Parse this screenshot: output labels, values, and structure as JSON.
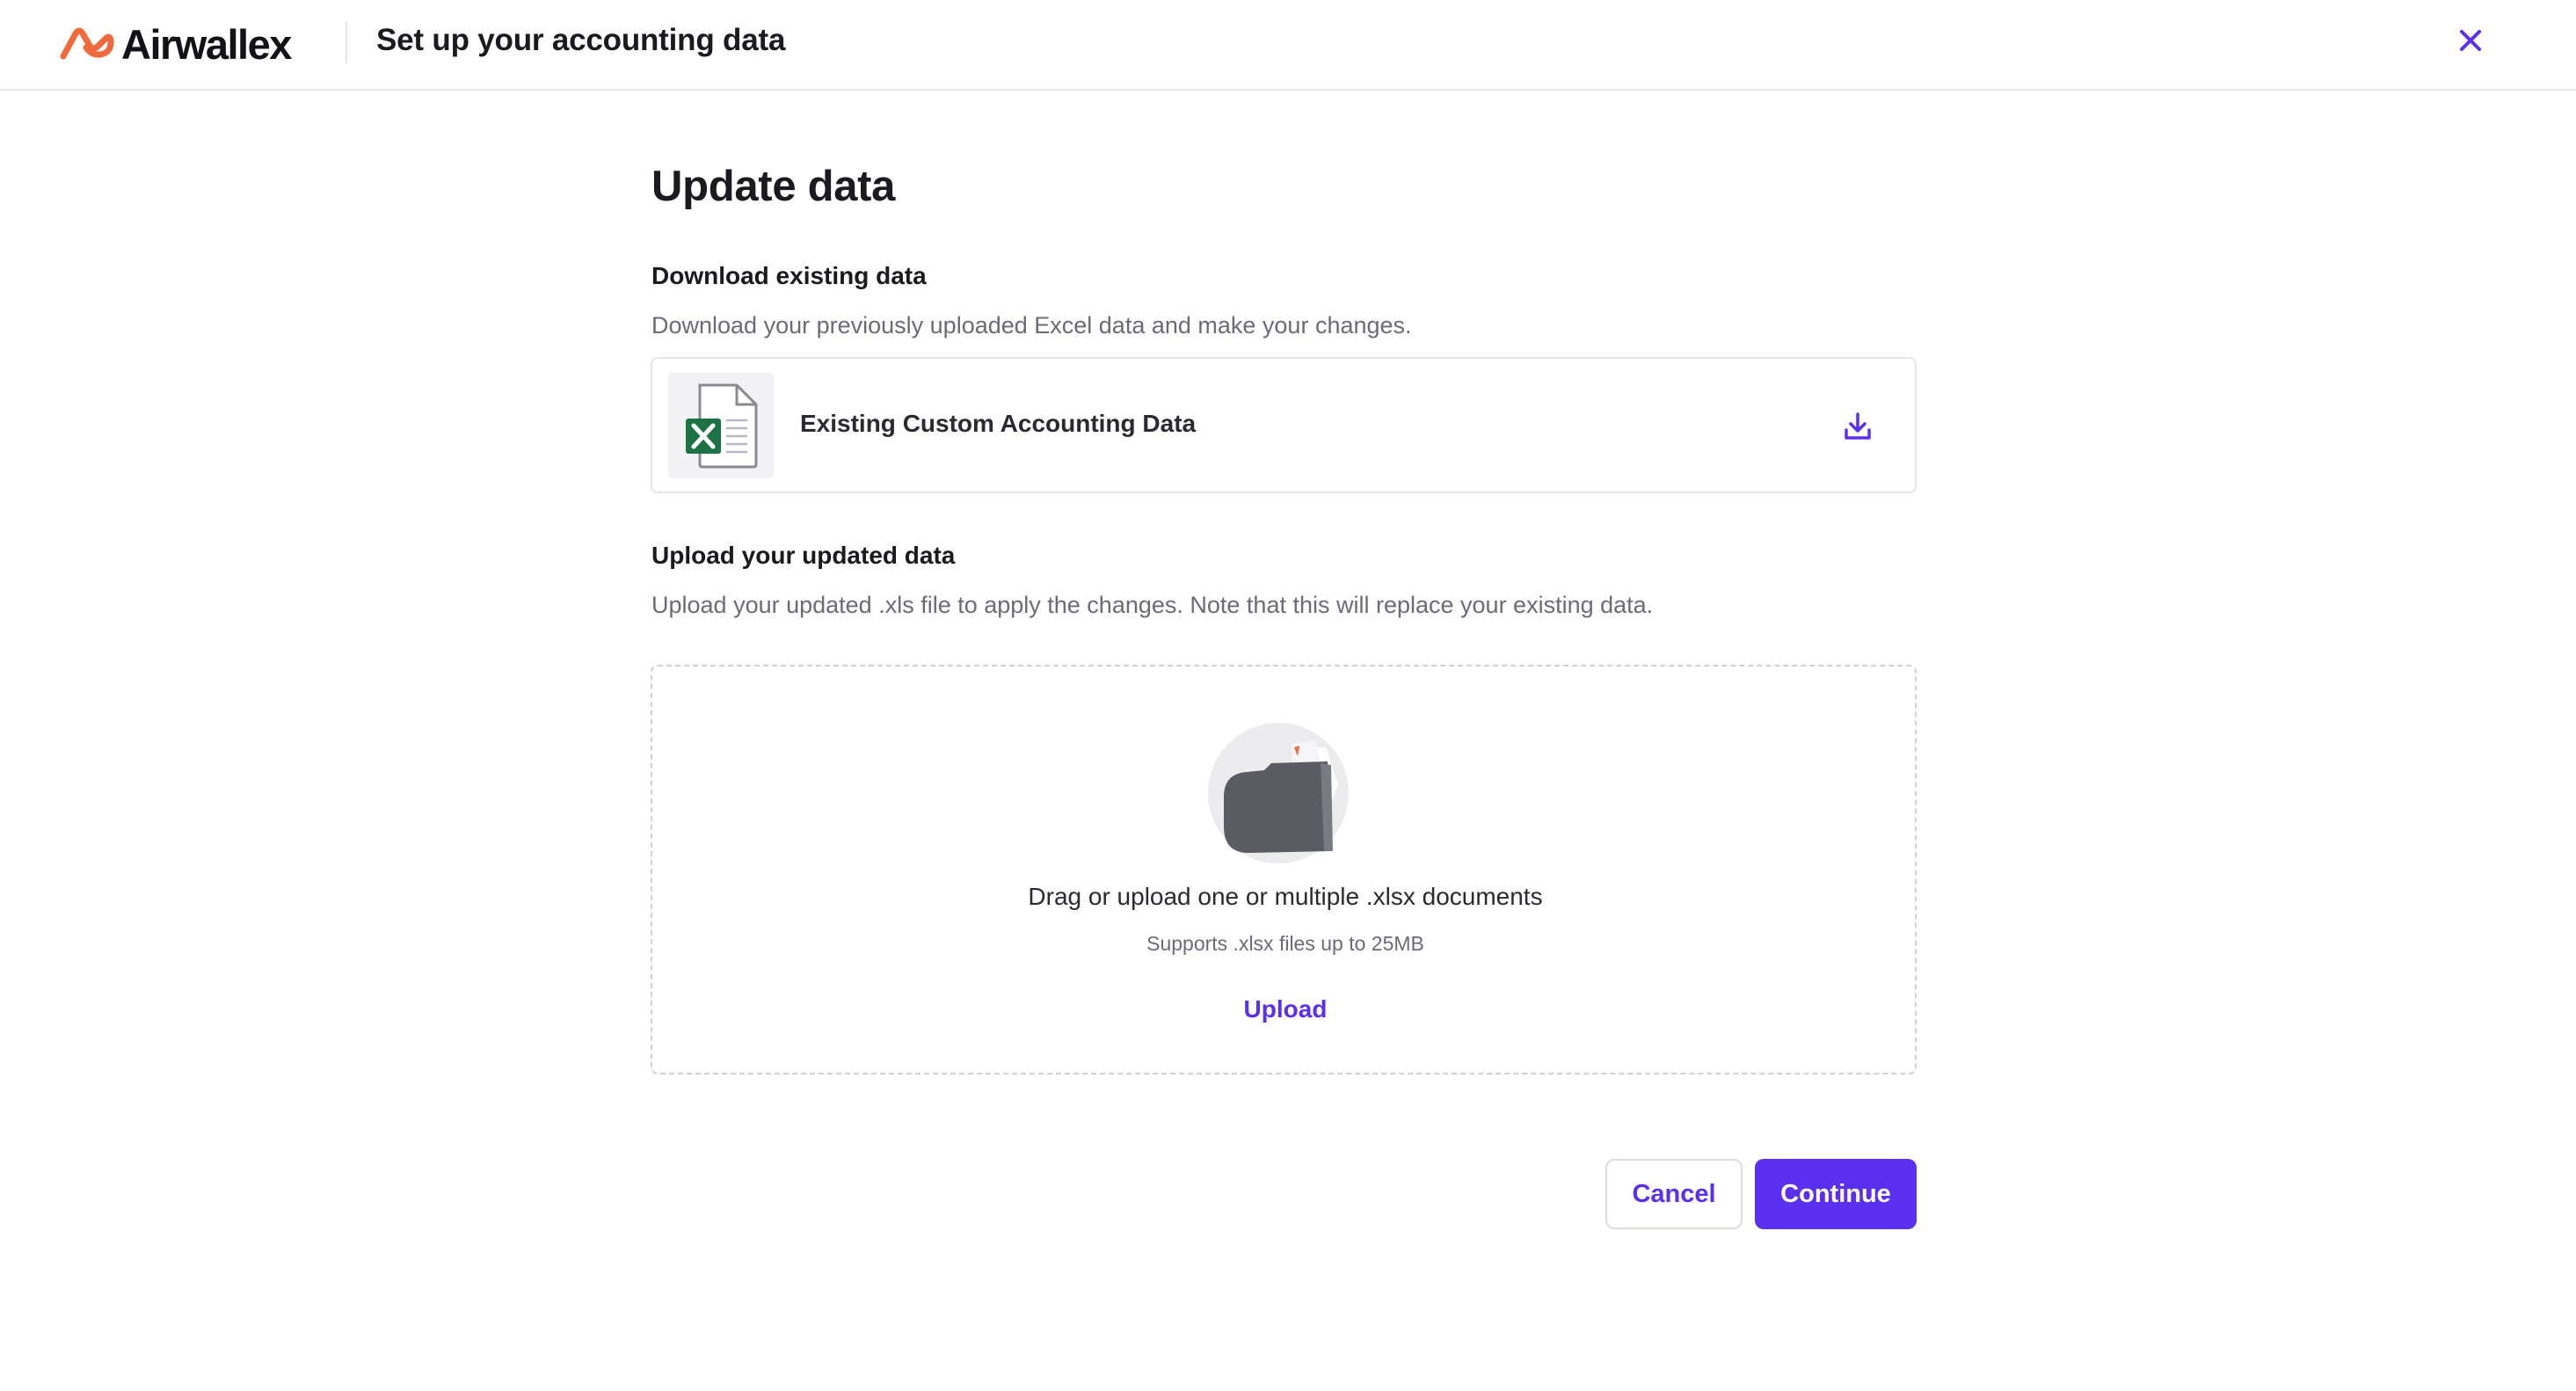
{
  "header": {
    "logo_text": "Airwallex",
    "title": "Set up your accounting data",
    "close_icon": "close-icon"
  },
  "page": {
    "title": "Update data"
  },
  "download_section": {
    "heading": "Download existing data",
    "description": "Download your previously uploaded Excel data and make your changes.",
    "file": {
      "name": "Existing Custom Accounting Data",
      "icon": "excel-file-icon",
      "action_icon": "download-icon"
    }
  },
  "upload_section": {
    "heading": "Upload your updated data",
    "description": "Upload your updated .xls file to apply the changes. Note that this will replace your existing data.",
    "dropzone": {
      "illustration": "folder-icon",
      "main_text": "Drag or upload one or multiple .xlsx documents",
      "sub_text": "Supports .xlsx files up to 25MB",
      "upload_label": "Upload"
    }
  },
  "footer": {
    "cancel_label": "Cancel",
    "continue_label": "Continue"
  },
  "colors": {
    "accent": "#5a2ff0",
    "logo_orange": "#f06a3c",
    "excel_green": "#1e7145",
    "text_primary": "#1a1a1f",
    "text_secondary": "#6b6b78",
    "border": "#e6e6ea"
  }
}
